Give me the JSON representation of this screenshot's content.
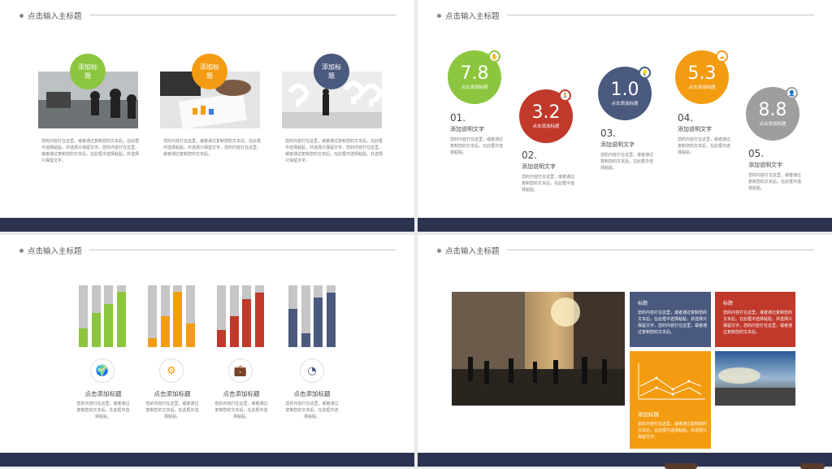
{
  "header": "点击输入主标题",
  "slide1": {
    "cards": [
      {
        "circle": "添加标题",
        "color": "#8cc63e",
        "text": "您的内容打在这里，或者通过复制您的文本后，在此框中选择粘贴，并选择只保留文字。您的内容打在这里，或者通过复制您的文本后，在此框中选择粘贴，并选择只保留文字。"
      },
      {
        "circle": "添加标题",
        "color": "#f39c12",
        "text": "您的内容打在这里，或者通过复制您的文本后，在此框中选择粘贴，并选择只保留文字。您的内容打在这里，或者通过复制您的文本后。"
      },
      {
        "circle": "添加标题",
        "color": "#4a5a7e",
        "text": "您的内容打在这里，或者通过复制您的文本后，在此框中选择粘贴，并选择只保留文字。您的内容打在这里，或者通过复制您的文本后，在此框中选择粘贴，并选择只保留文字。"
      }
    ]
  },
  "slide2": {
    "items": [
      {
        "value": "7.8",
        "label": "点击添加标题",
        "num": "01.",
        "title": "添加说明文字",
        "text": "您的内容打在这里，或者通过复制您的文本后，在此框中选择粘贴。",
        "color": "#8cc63e",
        "icon": "hand-icon"
      },
      {
        "value": "3.2",
        "label": "点击添加标题",
        "num": "02.",
        "title": "添加说明文字",
        "text": "您的内容打在这里，或者通过复制您的文本后，在此框中选择粘贴。",
        "color": "#c0392b",
        "icon": "runner-icon"
      },
      {
        "value": "1.0",
        "label": "点击添加标题",
        "num": "03.",
        "title": "添加说明文字",
        "text": "您的内容打在这里，或者通过复制您的文本后，在此框中选择粘贴。",
        "color": "#4a5a7e",
        "icon": "bulb-icon"
      },
      {
        "value": "5.3",
        "label": "点击添加标题",
        "num": "04.",
        "title": "添加说明文字",
        "text": "您的内容打在这里，或者通过复制您的文本后，在此框中选择粘贴。",
        "color": "#f39c12",
        "icon": "cloud-icon"
      },
      {
        "value": "8.8",
        "label": "点击添加标题",
        "num": "05.",
        "title": "添加说明文字",
        "text": "您的内容打在这里，或者通过复制您的文本后，在此框中选择粘贴。",
        "color": "#9e9e9e",
        "icon": "person-icon"
      }
    ]
  },
  "slide3": {
    "groups": [
      {
        "color": "#8cc63e",
        "values": [
          0.3,
          0.55,
          0.7,
          0.9
        ],
        "icon": "globe-icon",
        "title": "点击添加标题",
        "text": "您的内容打在这里，或者通过复制您的文本后，在此框中选择粘贴。"
      },
      {
        "color": "#f39c12",
        "values": [
          0.15,
          0.5,
          0.9,
          0.38
        ],
        "icon": "gears-icon",
        "title": "点击添加标题",
        "text": "您的内容打在这里，或者通过复制您的文本后，在此框中选择粘贴。"
      },
      {
        "color": "#c0392b",
        "values": [
          0.28,
          0.5,
          0.78,
          0.88
        ],
        "icon": "briefcase-icon",
        "title": "点击添加标题",
        "text": "您的内容打在这里，或者通过复制您的文本后，在此框中选择粘贴。"
      },
      {
        "color": "#4a5a7e",
        "values": [
          0.62,
          0.22,
          0.8,
          0.88
        ],
        "icon": "chart-icon",
        "title": "点击添加标题",
        "text": "您的内容打在这里，或者通过复制您的文本后，在此框中选择粘贴。"
      }
    ]
  },
  "slide4": {
    "box1": {
      "title": "标题",
      "text": "您的内容打在这里，或者通过复制您的文本后，在此框中选择粘贴，并选择只保留文字。您的内容打在这里，或者通过复制您的文本后。",
      "color": "#4a5a7e"
    },
    "box2": {
      "title": "标题",
      "text": "您的内容打在这里，或者通过复制您的文本后，在此框中选择粘贴，并选择只保留文字。您的内容打在这里，或者通过复制您的文本后。",
      "color": "#c0392b"
    },
    "box3": {
      "title": "添加标题",
      "text": "您的内容打在这里，或者通过复制您的文本后，在此框中选择粘贴，并选择只保留文字。",
      "color": "#f39c12"
    }
  }
}
